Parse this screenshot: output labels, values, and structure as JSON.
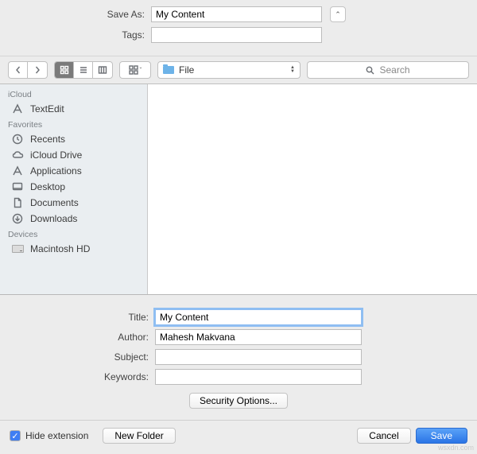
{
  "header": {
    "saveAsLabel": "Save As:",
    "saveAsValue": "My Content",
    "tagsLabel": "Tags:",
    "tagsValue": ""
  },
  "toolbar": {
    "pathLabel": "File",
    "searchPlaceholder": "Search"
  },
  "sidebar": {
    "sections": [
      {
        "title": "iCloud",
        "items": [
          {
            "icon": "textedit",
            "label": "TextEdit"
          }
        ]
      },
      {
        "title": "Favorites",
        "items": [
          {
            "icon": "clock",
            "label": "Recents"
          },
          {
            "icon": "cloud",
            "label": "iCloud Drive"
          },
          {
            "icon": "apps",
            "label": "Applications"
          },
          {
            "icon": "desktop",
            "label": "Desktop"
          },
          {
            "icon": "doc",
            "label": "Documents"
          },
          {
            "icon": "download",
            "label": "Downloads"
          }
        ]
      },
      {
        "title": "Devices",
        "items": [
          {
            "icon": "hd",
            "label": "Macintosh HD"
          }
        ]
      }
    ]
  },
  "form": {
    "titleLabel": "Title:",
    "titleValue": "My Content",
    "authorLabel": "Author:",
    "authorValue": "Mahesh Makvana",
    "subjectLabel": "Subject:",
    "subjectValue": "",
    "keywordsLabel": "Keywords:",
    "keywordsValue": "",
    "securityOptions": "Security Options..."
  },
  "footer": {
    "hideExtension": "Hide extension",
    "newFolder": "New Folder",
    "cancel": "Cancel",
    "save": "Save"
  },
  "watermark": "wsxdn.com"
}
